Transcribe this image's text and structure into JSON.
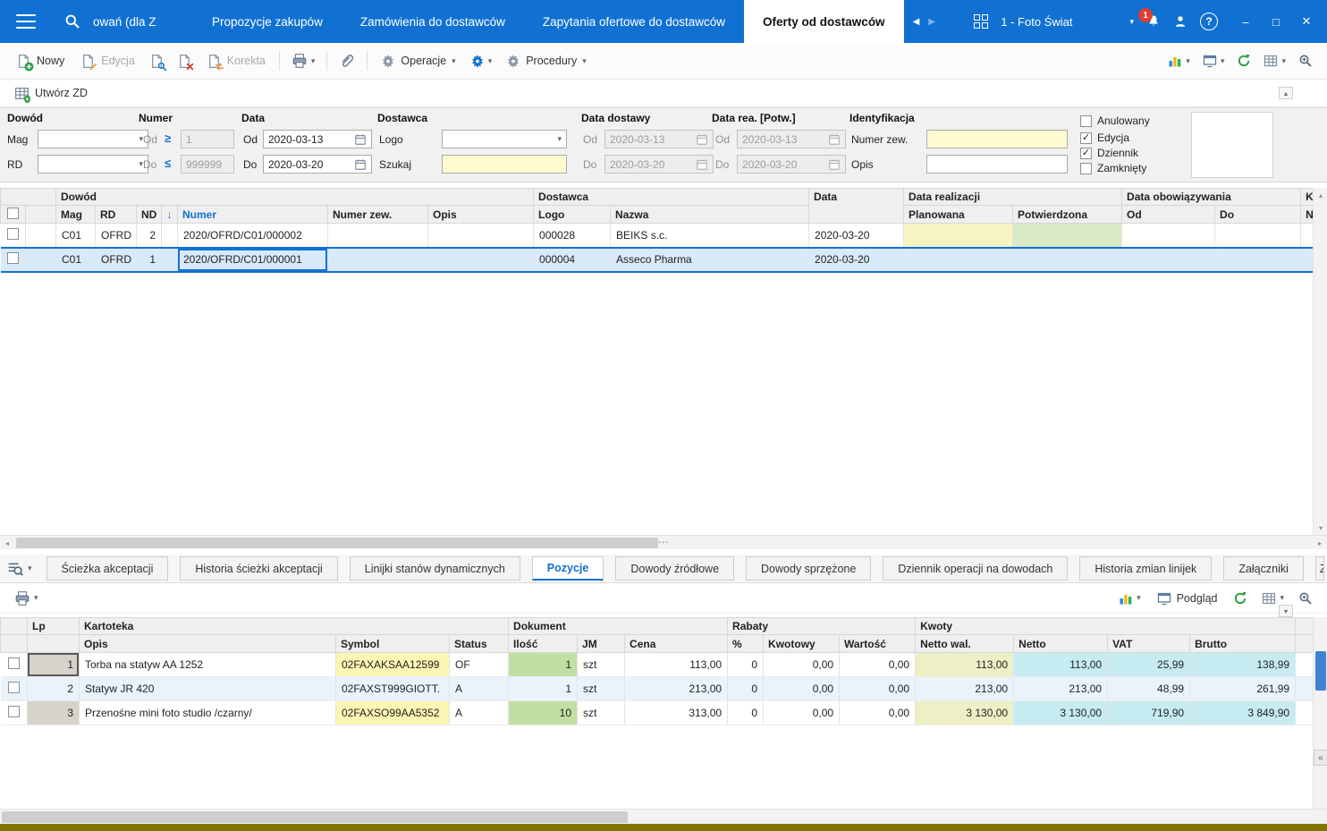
{
  "colors": {
    "accent": "#1171d2",
    "topbar": "#1171d2",
    "field_yellow": "#fffbd1",
    "cell_yellow": "#f8f3c2",
    "cell_green": "#d9ecc6",
    "cell_cyan": "#c6ecf1",
    "cell_olive": "#edf0c4",
    "cell_qty": "#c2dfa3",
    "sym_yellow": "#fcf6b4",
    "sel_row": "#d8eafa",
    "alt_row": "#eaf3fb",
    "lp_gray": "#d7d3cb",
    "badge_red": "#e23c32",
    "statusbar": "#7f7600"
  },
  "icons": {
    "chevron_down": "▾",
    "chevron_up": "▴",
    "tab_prev": "◀",
    "tab_next": "▶",
    "tri_left": "◂",
    "tri_right": "▸",
    "tri_up": "▴",
    "tri_down": "▾",
    "sort_down": "↓",
    "check": "✓",
    "ge": "≥",
    "le": "≤",
    "help": "?",
    "collapse_left": "«",
    "grip": "⋯",
    "minimize": "–",
    "maximize": "□",
    "close": "✕"
  },
  "topbar": {
    "workspace": "1 - Foto Świat",
    "notification_count": "1",
    "tabs": [
      {
        "label": "owań (dla Z",
        "active": false
      },
      {
        "label": "Propozycje zakupów",
        "active": false
      },
      {
        "label": "Zamówienia do dostawców",
        "active": false
      },
      {
        "label": "Zapytania ofertowe do dostawców",
        "active": false
      },
      {
        "label": "Oferty od dostawców",
        "active": true
      }
    ]
  },
  "toolbar": {
    "nowy": "Nowy",
    "edycja": "Edycja",
    "korekta": "Korekta",
    "operacje": "Operacje",
    "procedury": "Procedury",
    "utworz_zd": "Utwórz ZD",
    "podglad": "Podgląd"
  },
  "filters": {
    "dowod": {
      "title": "Dowód",
      "mag_label": "Mag",
      "rd_label": "RD",
      "mag_value": "",
      "rd_value": ""
    },
    "numer": {
      "title": "Numer",
      "od_label": "Od",
      "do_label": "Do",
      "od_value": "1",
      "do_value": "999999"
    },
    "data": {
      "title": "Data",
      "od_label": "Od",
      "do_label": "Do",
      "od_value": "2020-03-13",
      "do_value": "2020-03-20"
    },
    "dostawca": {
      "title": "Dostawca",
      "logo_label": "Logo",
      "szukaj_label": "Szukaj",
      "logo_value": "",
      "szukaj_value": ""
    },
    "data_dostawy": {
      "title": "Data dostawy",
      "od_label": "Od",
      "do_label": "Do",
      "od_value": "2020-03-13",
      "do_value": "2020-03-20"
    },
    "data_rea": {
      "title": "Data rea. [Potw.]",
      "od_label": "Od",
      "do_label": "Do",
      "od_value": "2020-03-13",
      "do_value": "2020-03-20"
    },
    "identyfikacja": {
      "title": "Identyfikacja",
      "numer_zew_label": "Numer zew.",
      "opis_label": "Opis",
      "numer_zew_value": "",
      "opis_value": ""
    },
    "checkboxes": [
      {
        "label": "Anulowany",
        "checked": false,
        "mark": ""
      },
      {
        "label": "Edycja",
        "checked": true,
        "mark": "✓"
      },
      {
        "label": "Dziennik",
        "checked": true,
        "mark": "✓"
      },
      {
        "label": "Zamknięty",
        "checked": false,
        "mark": ""
      }
    ]
  },
  "main_table": {
    "groups": {
      "dowod": "Dowód",
      "dostawca": "Dostawca",
      "data": "Data",
      "data_realizacji": "Data realizacji",
      "data_obowiazywania": "Data obowiązywania",
      "k_clipped": "K"
    },
    "columns": {
      "mag": "Mag",
      "rd": "RD",
      "nd": "ND",
      "numer": "Numer",
      "numer_zew": "Numer zew.",
      "opis": "Opis",
      "logo": "Logo",
      "nazwa": "Nazwa",
      "planowana": "Planowana",
      "potwierdzona": "Potwierdzona",
      "od": "Od",
      "do": "Do",
      "n_clipped": "N"
    },
    "rows": [
      {
        "mag": "C01",
        "rd": "OFRD",
        "nd": "2",
        "numer": "2020/OFRD/C01/000002",
        "numer_zew": "",
        "opis": "",
        "logo": "000028",
        "nazwa": "BEIKS s.c.",
        "data": "2020-03-20"
      },
      {
        "mag": "C01",
        "rd": "OFRD",
        "nd": "1",
        "numer": "2020/OFRD/C01/000001",
        "numer_zew": "",
        "opis": "",
        "logo": "000004",
        "nazwa": "Asseco Pharma",
        "data": "2020-03-20"
      }
    ]
  },
  "bottom_tabs": {
    "items": [
      {
        "label": "Ścieżka akceptacji",
        "active": false
      },
      {
        "label": "Historia ścieżki akceptacji",
        "active": false
      },
      {
        "label": "Linijki stanów dynamicznych",
        "active": false
      },
      {
        "label": "Pozycje",
        "active": true
      },
      {
        "label": "Dowody źródłowe",
        "active": false
      },
      {
        "label": "Dowody sprzężone",
        "active": false
      },
      {
        "label": "Dziennik operacji na dowodach",
        "active": false
      },
      {
        "label": "Historia zmian linijek",
        "active": false
      },
      {
        "label": "Załączniki",
        "active": false
      },
      {
        "label": "Zał",
        "active": false
      }
    ]
  },
  "positions_table": {
    "groups": {
      "lp": "Lp",
      "kartoteka": "Kartoteka",
      "dokument": "Dokument",
      "rabaty": "Rabaty",
      "kwoty": "Kwoty"
    },
    "columns": {
      "opis": "Opis",
      "symbol": "Symbol",
      "status": "Status",
      "ilosc": "Ilość",
      "jm": "JM",
      "cena": "Cena",
      "procent": "%",
      "kwotowy": "Kwotowy",
      "wartosc": "Wartość",
      "netto_wal": "Netto wal.",
      "netto": "Netto",
      "vat": "VAT",
      "brutto": "Brutto"
    },
    "rows": [
      {
        "lp": "1",
        "opis": "Torba na statyw AA 1252",
        "symbol": "02FAXAKSAA12599",
        "status": "OF",
        "ilosc": "1",
        "jm": "szt",
        "cena": "113,00",
        "procent": "0",
        "kwotowy": "0,00",
        "wartosc": "0,00",
        "netto_wal": "113,00",
        "netto": "113,00",
        "vat": "25,99",
        "brutto": "138,99"
      },
      {
        "lp": "2",
        "opis": "Statyw JR 420",
        "symbol": "02FAXST999GIOTT.",
        "status": "A",
        "ilosc": "1",
        "jm": "szt",
        "cena": "213,00",
        "procent": "0",
        "kwotowy": "0,00",
        "wartosc": "0,00",
        "netto_wal": "213,00",
        "netto": "213,00",
        "vat": "48,99",
        "brutto": "261,99"
      },
      {
        "lp": "3",
        "opis": "Przenośne mini foto studio /czarny/",
        "symbol": "02FAXSO99AA5352",
        "status": "A",
        "ilosc": "10",
        "jm": "szt",
        "cena": "313,00",
        "procent": "0",
        "kwotowy": "0,00",
        "wartosc": "0,00",
        "netto_wal": "3 130,00",
        "netto": "3 130,00",
        "vat": "719,90",
        "brutto": "3 849,90"
      }
    ]
  }
}
